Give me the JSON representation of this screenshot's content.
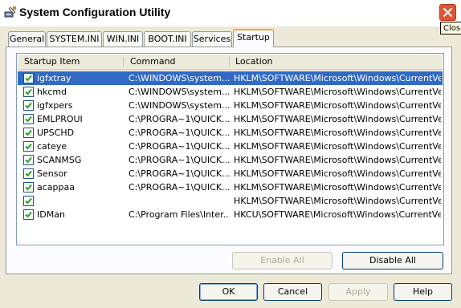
{
  "window": {
    "title": "System Configuration Utility",
    "close_tooltip": "Close"
  },
  "tabs": [
    {
      "label": "General"
    },
    {
      "label": "SYSTEM.INI"
    },
    {
      "label": "WIN.INI"
    },
    {
      "label": "BOOT.INI"
    },
    {
      "label": "Services"
    },
    {
      "label": "Startup"
    }
  ],
  "active_tab": "Startup",
  "list": {
    "columns": [
      "Startup Item",
      "Command",
      "Location"
    ],
    "rows": [
      {
        "checked": true,
        "item": "igfxtray",
        "command": "C:\\WINDOWS\\system...",
        "location": "HKLM\\SOFTWARE\\Microsoft\\Windows\\CurrentVer...",
        "selected": true
      },
      {
        "checked": true,
        "item": "hkcmd",
        "command": "C:\\WINDOWS\\system...",
        "location": "HKLM\\SOFTWARE\\Microsoft\\Windows\\CurrentVer..."
      },
      {
        "checked": true,
        "item": "igfxpers",
        "command": "C:\\WINDOWS\\system...",
        "location": "HKLM\\SOFTWARE\\Microsoft\\Windows\\CurrentVer..."
      },
      {
        "checked": true,
        "item": "EMLPROUI",
        "command": "C:\\PROGRA~1\\QUICK...",
        "location": "HKLM\\SOFTWARE\\Microsoft\\Windows\\CurrentVer..."
      },
      {
        "checked": true,
        "item": "UPSCHD",
        "command": "C:\\PROGRA~1\\QUICK...",
        "location": "HKLM\\SOFTWARE\\Microsoft\\Windows\\CurrentVer..."
      },
      {
        "checked": true,
        "item": "cateye",
        "command": "C:\\PROGRA~1\\QUICK...",
        "location": "HKLM\\SOFTWARE\\Microsoft\\Windows\\CurrentVer..."
      },
      {
        "checked": true,
        "item": "SCANMSG",
        "command": "C:\\PROGRA~1\\QUICK...",
        "location": "HKLM\\SOFTWARE\\Microsoft\\Windows\\CurrentVer..."
      },
      {
        "checked": true,
        "item": "Sensor",
        "command": "C:\\PROGRA~1\\QUICK...",
        "location": "HKLM\\SOFTWARE\\Microsoft\\Windows\\CurrentVer..."
      },
      {
        "checked": true,
        "item": "acappaa",
        "command": "C:\\PROGRA~1\\QUICK...",
        "location": "HKLM\\SOFTWARE\\Microsoft\\Windows\\CurrentVer..."
      },
      {
        "checked": true,
        "item": "",
        "command": "",
        "location": "HKLM\\SOFTWARE\\Microsoft\\Windows\\CurrentVer..."
      },
      {
        "checked": true,
        "item": "IDMan",
        "command": "C:\\Program Files\\Inter...",
        "location": "HKCU\\SOFTWARE\\Microsoft\\Windows\\CurrentVer..."
      }
    ]
  },
  "panel_buttons": {
    "enable_all": "Enable All",
    "disable_all": "Disable All"
  },
  "dialog_buttons": {
    "ok": "OK",
    "cancel": "Cancel",
    "apply": "Apply",
    "help": "Help"
  },
  "colors": {
    "selection": "#316ac5",
    "close_red": "#e05535",
    "active_tab_accent": "#ff9e3b",
    "window_bg": "#ece9d8"
  }
}
